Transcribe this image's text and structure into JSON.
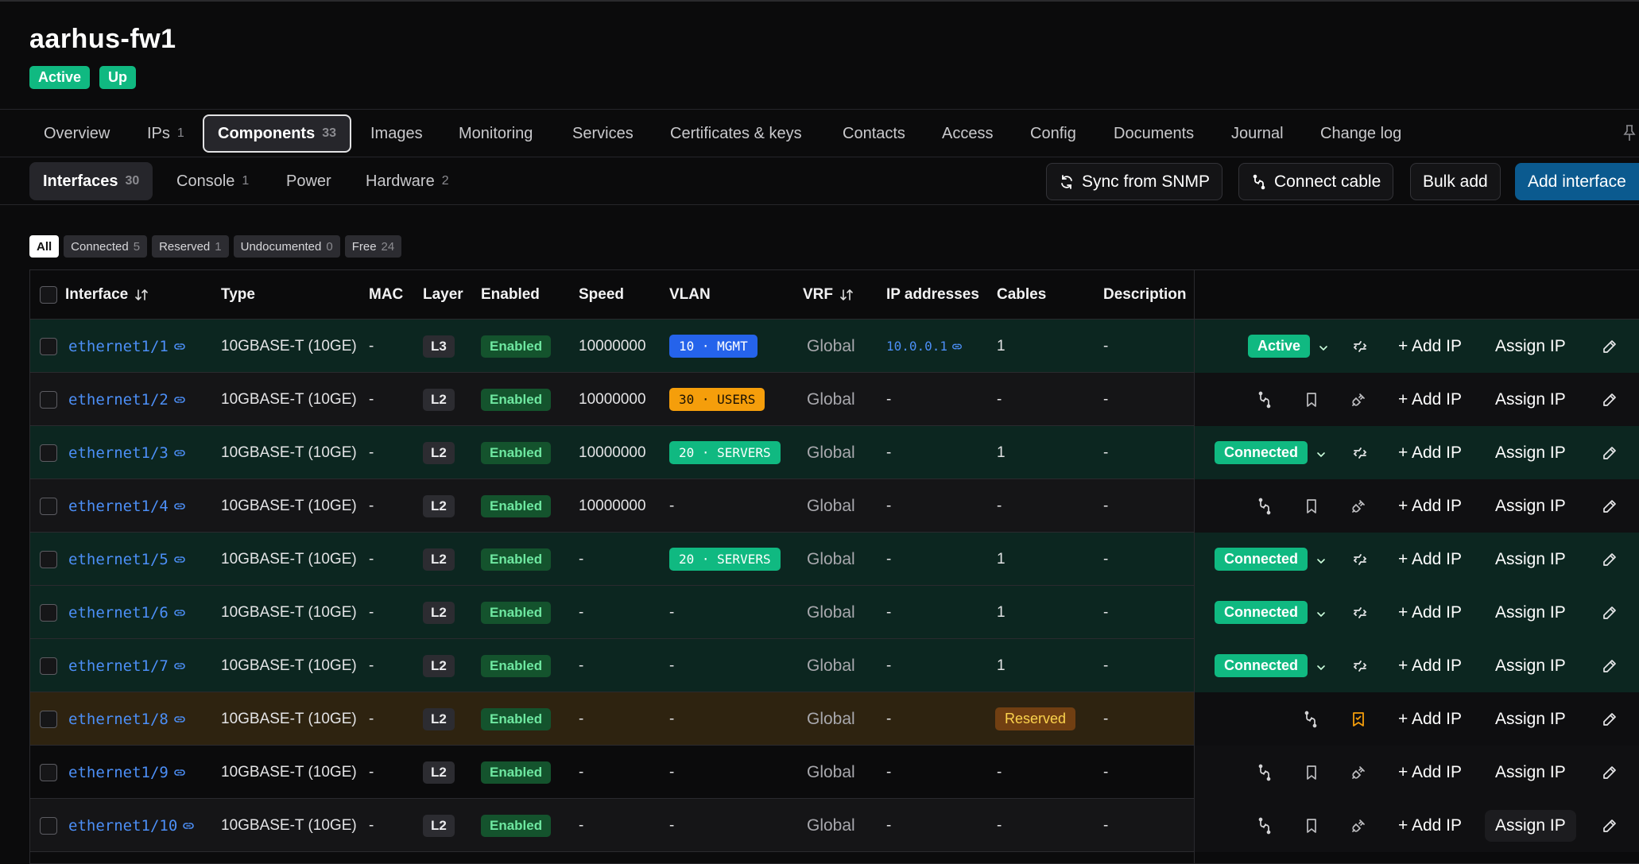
{
  "device": {
    "name": "aarhus-fw1",
    "badges": [
      "Active",
      "Up"
    ]
  },
  "tabs": [
    {
      "label": "Overview",
      "count": ""
    },
    {
      "label": "IPs",
      "count": "1"
    },
    {
      "label": "Components",
      "count": "33"
    },
    {
      "label": "Images",
      "count": ""
    },
    {
      "label": "Monitoring",
      "count": ""
    },
    {
      "label": "Services",
      "count": ""
    },
    {
      "label": "Certificates & keys",
      "count": ""
    },
    {
      "label": "Contacts",
      "count": ""
    },
    {
      "label": "Access",
      "count": ""
    },
    {
      "label": "Config",
      "count": ""
    },
    {
      "label": "Documents",
      "count": ""
    },
    {
      "label": "Journal",
      "count": ""
    },
    {
      "label": "Change log",
      "count": ""
    }
  ],
  "subtabs": [
    {
      "label": "Interfaces",
      "count": "30"
    },
    {
      "label": "Console",
      "count": "1"
    },
    {
      "label": "Power",
      "count": ""
    },
    {
      "label": "Hardware",
      "count": "2"
    }
  ],
  "actions": {
    "sync": "Sync from SNMP",
    "connect": "Connect cable",
    "bulk": "Bulk add",
    "add": "Add interface"
  },
  "filters": [
    {
      "label": "All",
      "count": ""
    },
    {
      "label": "Connected",
      "count": "5"
    },
    {
      "label": "Reserved",
      "count": "1"
    },
    {
      "label": "Undocumented",
      "count": "0"
    },
    {
      "label": "Free",
      "count": "24"
    }
  ],
  "columns": {
    "interface": "Interface",
    "type": "Type",
    "mac": "MAC",
    "layer": "Layer",
    "enabled": "Enabled",
    "speed": "Speed",
    "vlan": "VLAN",
    "vrf": "VRF",
    "ips": "IP addresses",
    "cables": "Cables",
    "description": "Description"
  },
  "row_actions": {
    "add_ip": "+ Add IP",
    "assign_ip": "Assign IP"
  },
  "rows": [
    {
      "name": "ethernet1/1",
      "type": "10GBASE-T (10GE)",
      "mac": "-",
      "layer": "L3",
      "enabled": "Enabled",
      "speed": "10000000",
      "vlan": "10 · MGMT",
      "vlan_color": "blue",
      "vrf": "Global",
      "ip": "10.0.0.1",
      "cables": "1",
      "description": "-",
      "status": "Active",
      "bg": "green"
    },
    {
      "name": "ethernet1/2",
      "type": "10GBASE-T (10GE)",
      "mac": "-",
      "layer": "L2",
      "enabled": "Enabled",
      "speed": "10000000",
      "vlan": "30 · USERS",
      "vlan_color": "amber",
      "vrf": "Global",
      "ip": "-",
      "cables": "-",
      "description": "-",
      "status": "",
      "bg": "dark"
    },
    {
      "name": "ethernet1/3",
      "type": "10GBASE-T (10GE)",
      "mac": "-",
      "layer": "L2",
      "enabled": "Enabled",
      "speed": "10000000",
      "vlan": "20 · SERVERS",
      "vlan_color": "green",
      "vrf": "Global",
      "ip": "-",
      "cables": "1",
      "description": "-",
      "status": "Connected",
      "bg": "green"
    },
    {
      "name": "ethernet1/4",
      "type": "10GBASE-T (10GE)",
      "mac": "-",
      "layer": "L2",
      "enabled": "Enabled",
      "speed": "10000000",
      "vlan": "-",
      "vlan_color": "",
      "vrf": "Global",
      "ip": "-",
      "cables": "-",
      "description": "-",
      "status": "",
      "bg": "dark"
    },
    {
      "name": "ethernet1/5",
      "type": "10GBASE-T (10GE)",
      "mac": "-",
      "layer": "L2",
      "enabled": "Enabled",
      "speed": "-",
      "vlan": "20 · SERVERS",
      "vlan_color": "green",
      "vrf": "Global",
      "ip": "-",
      "cables": "1",
      "description": "-",
      "status": "Connected",
      "bg": "green"
    },
    {
      "name": "ethernet1/6",
      "type": "10GBASE-T (10GE)",
      "mac": "-",
      "layer": "L2",
      "enabled": "Enabled",
      "speed": "-",
      "vlan": "-",
      "vlan_color": "",
      "vrf": "Global",
      "ip": "-",
      "cables": "1",
      "description": "-",
      "status": "Connected",
      "bg": "green"
    },
    {
      "name": "ethernet1/7",
      "type": "10GBASE-T (10GE)",
      "mac": "-",
      "layer": "L2",
      "enabled": "Enabled",
      "speed": "-",
      "vlan": "-",
      "vlan_color": "",
      "vrf": "Global",
      "ip": "-",
      "cables": "1",
      "description": "-",
      "status": "Connected",
      "bg": "green"
    },
    {
      "name": "ethernet1/8",
      "type": "10GBASE-T (10GE)",
      "mac": "-",
      "layer": "L2",
      "enabled": "Enabled",
      "speed": "-",
      "vlan": "-",
      "vlan_color": "",
      "vrf": "Global",
      "ip": "-",
      "cables": "Reserved",
      "description": "-",
      "status": "",
      "bg": "amber"
    },
    {
      "name": "ethernet1/9",
      "type": "10GBASE-T (10GE)",
      "mac": "-",
      "layer": "L2",
      "enabled": "Enabled",
      "speed": "-",
      "vlan": "-",
      "vlan_color": "",
      "vrf": "Global",
      "ip": "-",
      "cables": "-",
      "description": "-",
      "status": "",
      "bg": "black"
    },
    {
      "name": "ethernet1/10",
      "type": "10GBASE-T (10GE)",
      "mac": "-",
      "layer": "L2",
      "enabled": "Enabled",
      "speed": "-",
      "vlan": "-",
      "vlan_color": "",
      "vrf": "Global",
      "ip": "-",
      "cables": "-",
      "description": "-",
      "status": "",
      "bg": "dark"
    }
  ]
}
